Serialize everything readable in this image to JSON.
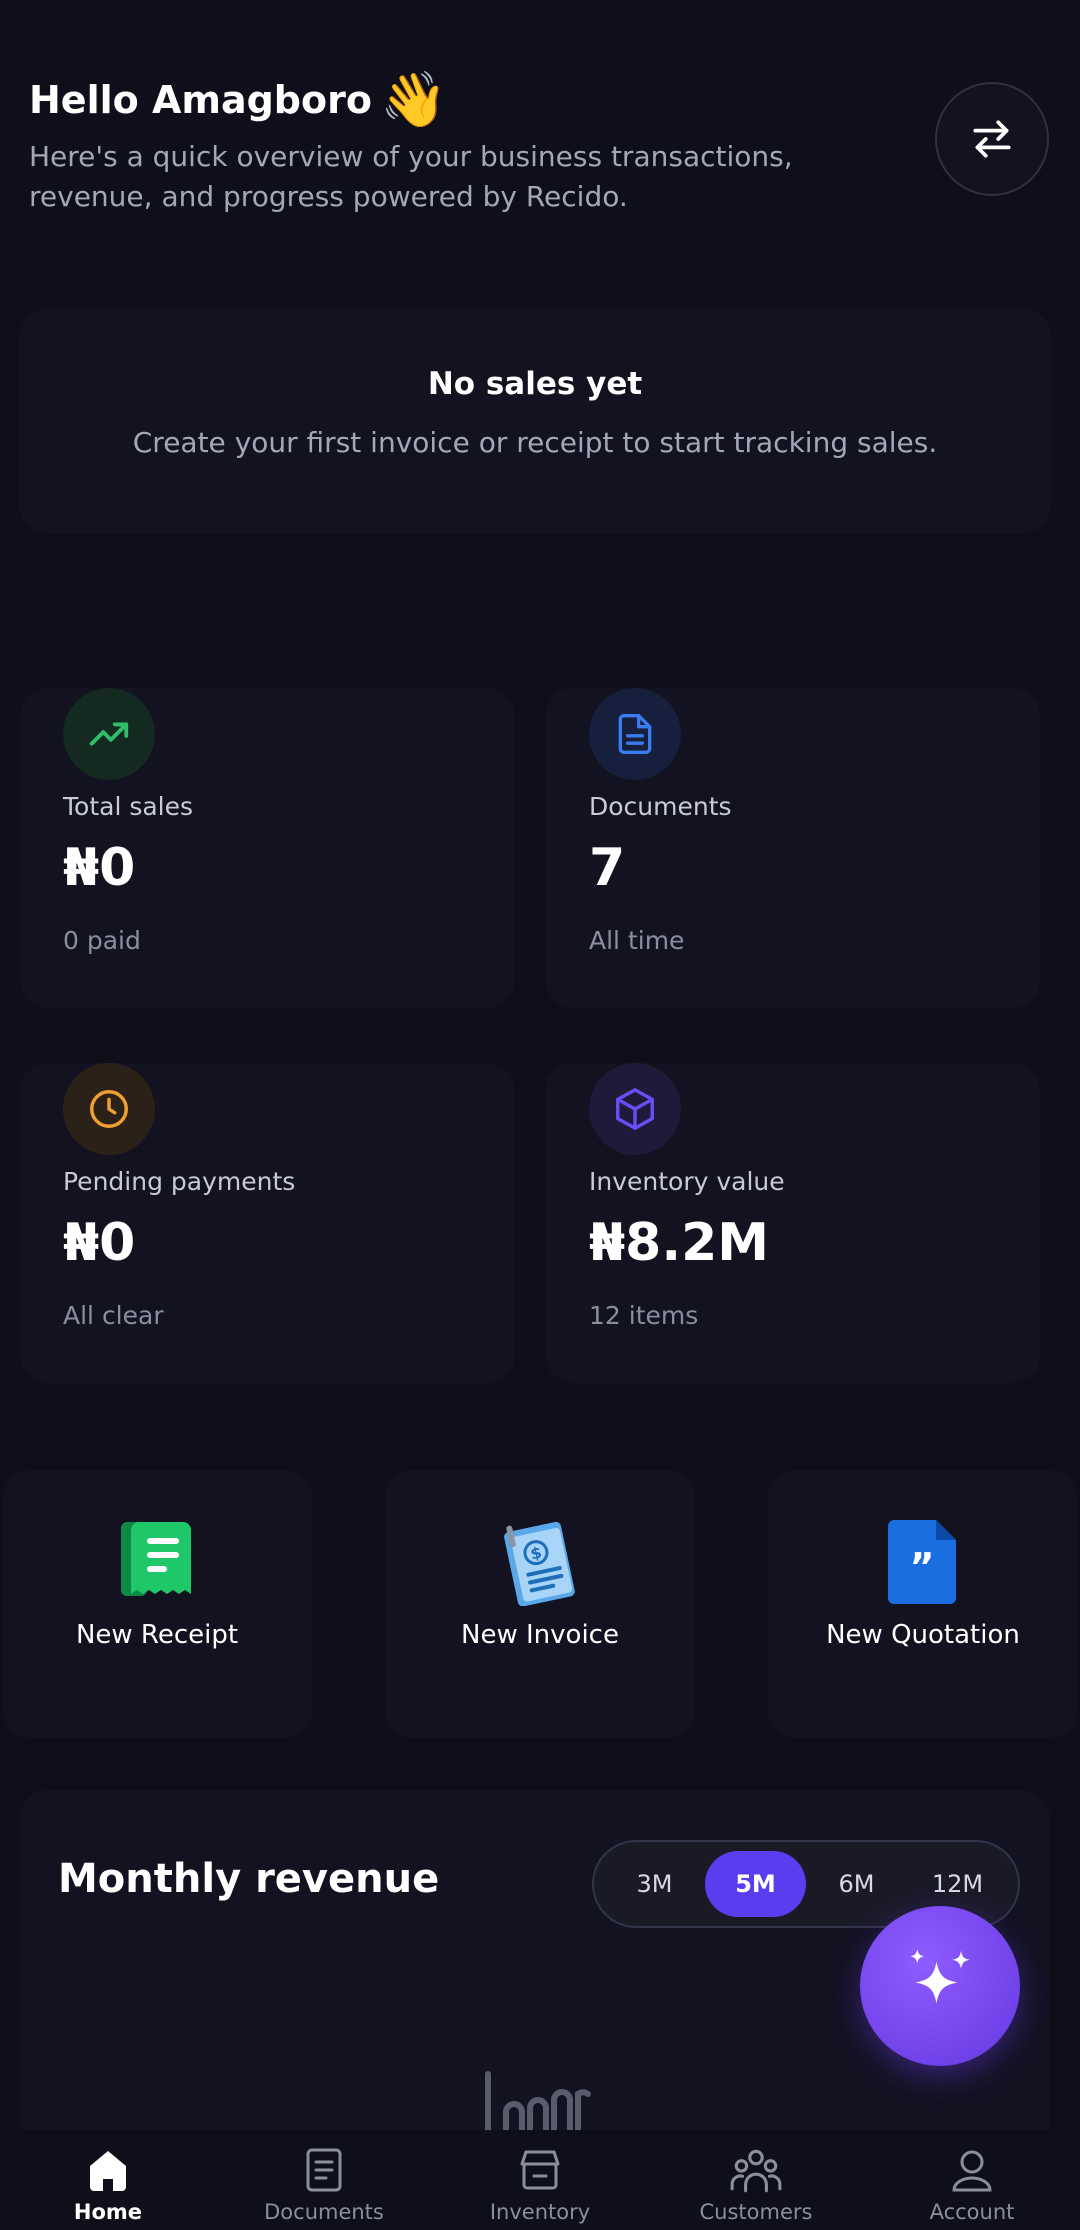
{
  "header": {
    "greeting": "Hello Amagboro",
    "wave_emoji": "👋",
    "subtitle": "Here's a quick overview of your business transactions, revenue, and progress powered by Recido.",
    "switch_icon": "swap-arrows-icon"
  },
  "empty_state": {
    "title": "No sales yet",
    "message": "Create your first invoice or receipt to start tracking sales."
  },
  "stats": [
    {
      "label": "Total sales",
      "value": "₦0",
      "sub": "0 paid",
      "icon": "trend-up-icon",
      "color": "#2fbf6c"
    },
    {
      "label": "Documents",
      "value": "7",
      "sub": "All time",
      "icon": "document-icon",
      "color": "#3b7cf0"
    },
    {
      "label": "Pending payments",
      "value": "₦0",
      "sub": "All clear",
      "icon": "clock-icon",
      "color": "#f0a030"
    },
    {
      "label": "Inventory value",
      "value": "₦8.2M",
      "sub": "12 items",
      "icon": "cube-icon",
      "color": "#6a4df5"
    }
  ],
  "actions": [
    {
      "label": "New Receipt",
      "icon": "receipt-icon"
    },
    {
      "label": "New Invoice",
      "icon": "invoice-icon"
    },
    {
      "label": "New Quotation",
      "icon": "quotation-icon"
    }
  ],
  "revenue": {
    "title": "Monthly revenue",
    "ranges": [
      "3M",
      "5M",
      "6M",
      "12M"
    ],
    "selected": "5M"
  },
  "fab_icon": "sparkles-icon",
  "nav": [
    {
      "label": "Home",
      "icon": "home-icon",
      "active": true
    },
    {
      "label": "Documents",
      "icon": "documents-icon",
      "active": false
    },
    {
      "label": "Inventory",
      "icon": "inventory-icon",
      "active": false
    },
    {
      "label": "Customers",
      "icon": "customers-icon",
      "active": false
    },
    {
      "label": "Account",
      "icon": "account-icon",
      "active": false
    }
  ],
  "colors": {
    "background": "#0f0f1b",
    "card": "#121221",
    "accent": "#5b3df0",
    "muted_text": "#a5a7b6"
  }
}
